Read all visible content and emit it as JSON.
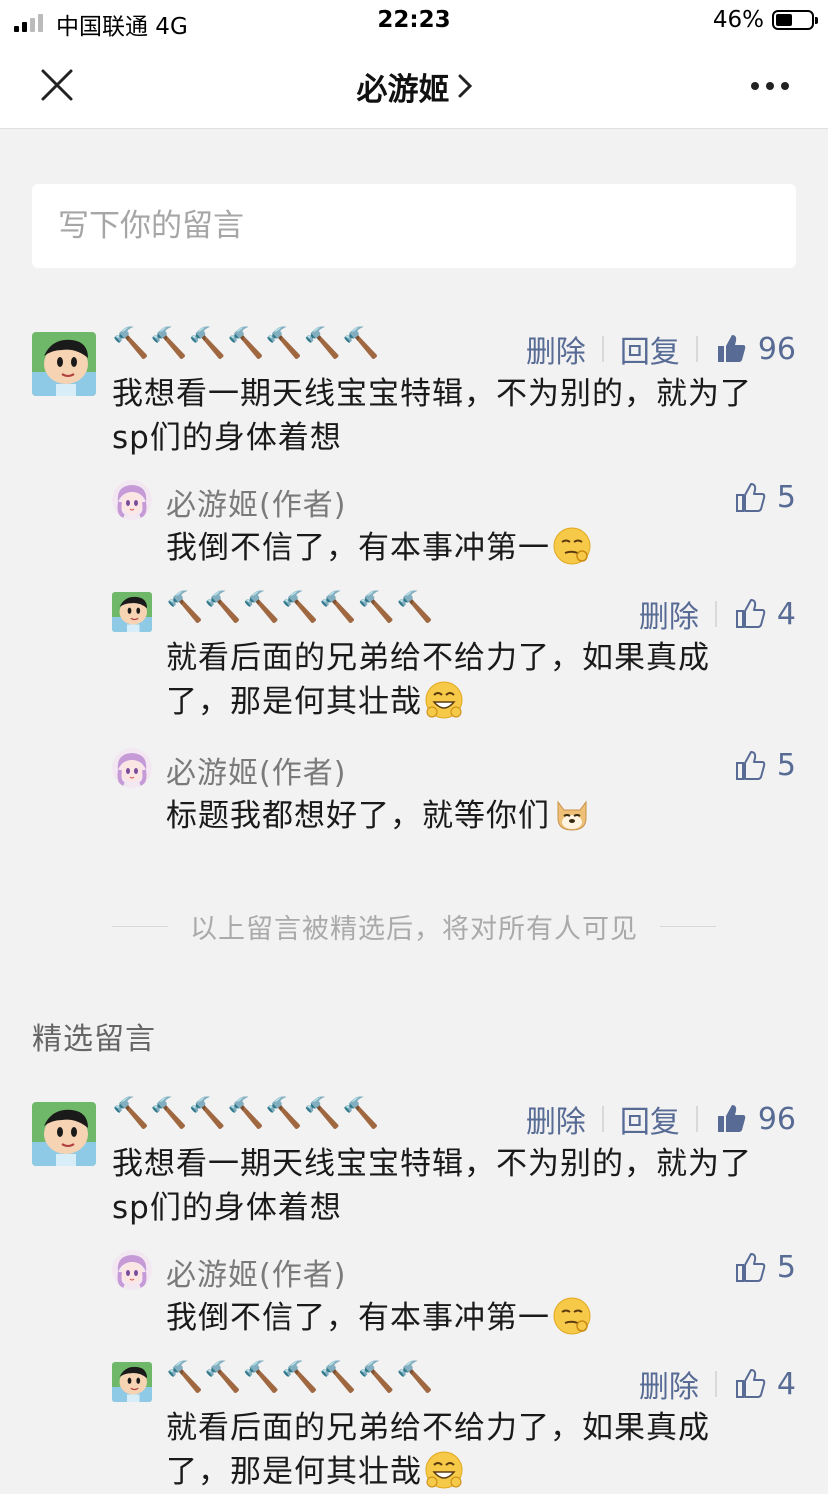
{
  "status_bar": {
    "carrier": "中国联通  4G",
    "time": "22:23",
    "battery": "46%",
    "battery_level": 0.46
  },
  "navbar": {
    "title": "必游姬"
  },
  "input": {
    "placeholder": "写下你的留言"
  },
  "labels": {
    "delete": "删除",
    "reply": "回复"
  },
  "comments_top": {
    "main": {
      "nick": "🔨🔨🔨🔨🔨🔨🔨",
      "likes": "96",
      "text_line1": "我想看一期天线宝宝特辑，不为别的，就为了",
      "text_line2": "sp们的身体着想"
    },
    "replies": [
      {
        "nick": "必游姬(作者)",
        "likes": "5",
        "text": "我倒不信了，有本事冲第一"
      },
      {
        "nick": "🔨🔨🔨🔨🔨🔨🔨",
        "likes": "4",
        "text_line1": "就看后面的兄弟给不给力了，如果真成",
        "text_line2": "了，那是何其壮哉"
      },
      {
        "nick": "必游姬(作者)",
        "likes": "5",
        "text": "标题我都想好了，就等你们"
      }
    ]
  },
  "divider_text": "以上留言被精选后，将对所有人可见",
  "section_title": "精选留言",
  "comments_selected": {
    "main": {
      "nick": "🔨🔨🔨🔨🔨🔨🔨",
      "likes": "96",
      "text_line1": "我想看一期天线宝宝特辑，不为别的，就为了",
      "text_line2": "sp们的身体着想"
    },
    "replies": [
      {
        "nick": "必游姬(作者)",
        "likes": "5",
        "text": "我倒不信了，有本事冲第一"
      },
      {
        "nick": "🔨🔨🔨🔨🔨🔨🔨",
        "likes": "4",
        "text_line1": "就看后面的兄弟给不给力了，如果真成",
        "text_line2": "了，那是何其壮哉"
      }
    ]
  },
  "colors": {
    "link": "#576b95",
    "background": "#f2f2f2"
  }
}
